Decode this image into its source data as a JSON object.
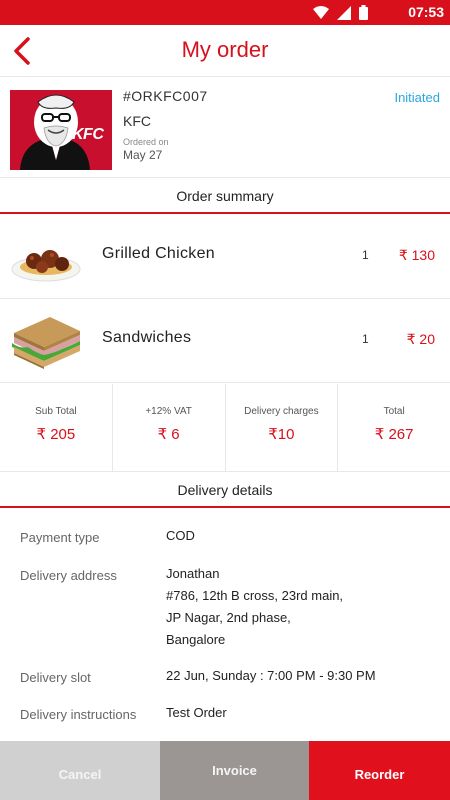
{
  "status_bar": {
    "time": "07:53",
    "icons": [
      "wifi-icon",
      "signal-icon",
      "battery-icon"
    ]
  },
  "header": {
    "title": "My order",
    "back_icon": "chevron-left-icon"
  },
  "order": {
    "id": "#ORKFC007",
    "store": "KFC",
    "logo_text": "KFC",
    "ordered_on_label": "Ordered on",
    "ordered_on_date": "May 27",
    "status": "Initiated"
  },
  "summary": {
    "title": "Order summary",
    "items": [
      {
        "name": "Grilled Chicken",
        "qty": "1",
        "price": "₹ 130"
      },
      {
        "name": "Sandwiches",
        "qty": "1",
        "price": "₹ 20"
      }
    ]
  },
  "totals": [
    {
      "label": "Sub Total",
      "value": "₹ 205"
    },
    {
      "label": "+12% VAT",
      "value": "₹ 6"
    },
    {
      "label": "Delivery charges",
      "value": "₹10"
    },
    {
      "label": "Total",
      "value": "₹ 267"
    }
  ],
  "delivery": {
    "title": "Delivery details",
    "payment_type_label": "Payment type",
    "payment_type": "COD",
    "address_label": "Delivery address",
    "address_lines": [
      "Jonathan",
      "#786, 12th B cross, 23rd main,",
      "JP Nagar, 2nd phase,",
      "Bangalore"
    ],
    "slot_label": "Delivery slot",
    "slot": "22 Jun, Sunday : 7:00 PM - 9:30 PM",
    "instructions_label": "Delivery instructions",
    "instructions": "Test Order"
  },
  "actions": {
    "cancel": "Cancel",
    "invoice": "Invoice",
    "reorder": "Reorder"
  },
  "colors": {
    "brand": "#d8101c",
    "status": "#29a8e0",
    "cancel_bg": "#d0d0d0",
    "invoice_bg": "#9b9593"
  }
}
